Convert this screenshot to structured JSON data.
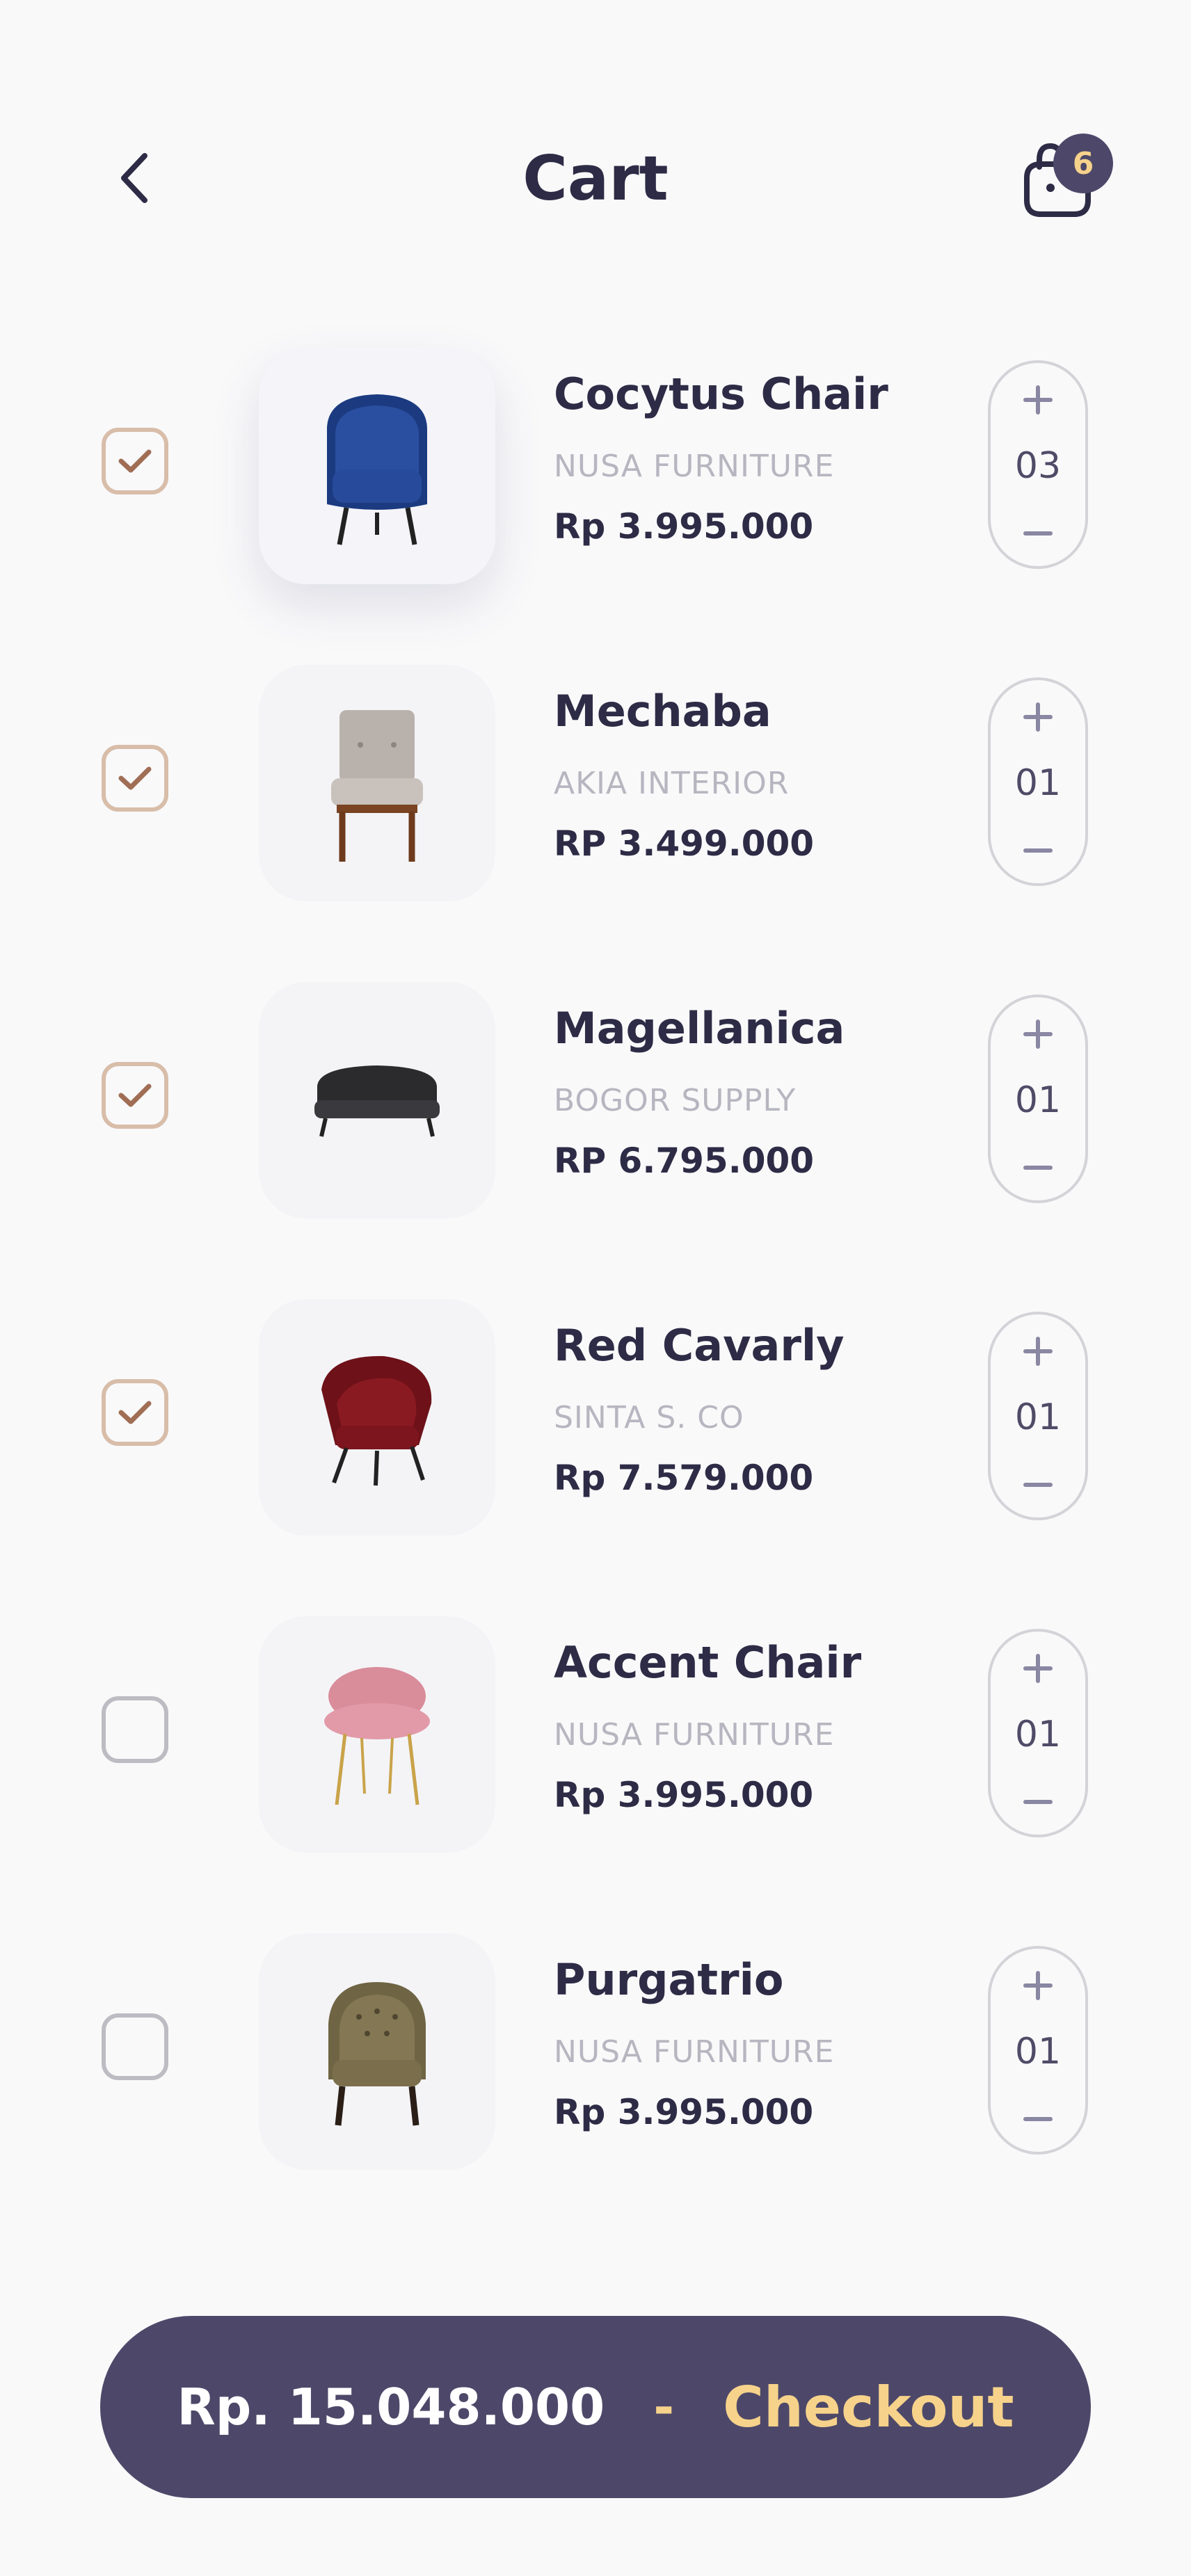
{
  "header": {
    "title": "Cart",
    "cart_count": "6"
  },
  "items": [
    {
      "name": "Cocytus Chair",
      "store": "NUSA FURNITURE",
      "price": "Rp 3.995.000",
      "qty": "03",
      "checked": true,
      "image": "blue-armchair"
    },
    {
      "name": "Mechaba",
      "store": "AKIA INTERIOR",
      "price": "RP 3.499.000",
      "qty": "01",
      "checked": true,
      "image": "grey-slipper-chair"
    },
    {
      "name": "Magellanica",
      "store": "BOGOR SUPPLY",
      "price": "RP 6.795.000",
      "qty": "01",
      "checked": true,
      "image": "black-loveseat"
    },
    {
      "name": "Red Cavarly",
      "store": "SINTA S. CO",
      "price": "Rp 7.579.000",
      "qty": "01",
      "checked": true,
      "image": "red-armchair"
    },
    {
      "name": "Accent Chair",
      "store": "NUSA FURNITURE",
      "price": "Rp 3.995.000",
      "qty": "01",
      "checked": false,
      "image": "pink-accent-chair"
    },
    {
      "name": "Purgatrio",
      "store": "NUSA FURNITURE",
      "price": "Rp 3.995.000",
      "qty": "01",
      "checked": false,
      "image": "tufted-armchair"
    }
  ],
  "checkout": {
    "total": "Rp. 15.048.000",
    "separator": "-",
    "label": "Checkout"
  },
  "colors": {
    "accent": "#4d4869",
    "highlight": "#f6d28b",
    "check": "#a06e55"
  },
  "icons": {
    "back": "chevron-left-icon",
    "cart": "bag-icon",
    "check": "check-icon",
    "plus": "plus-icon",
    "minus": "minus-icon"
  }
}
